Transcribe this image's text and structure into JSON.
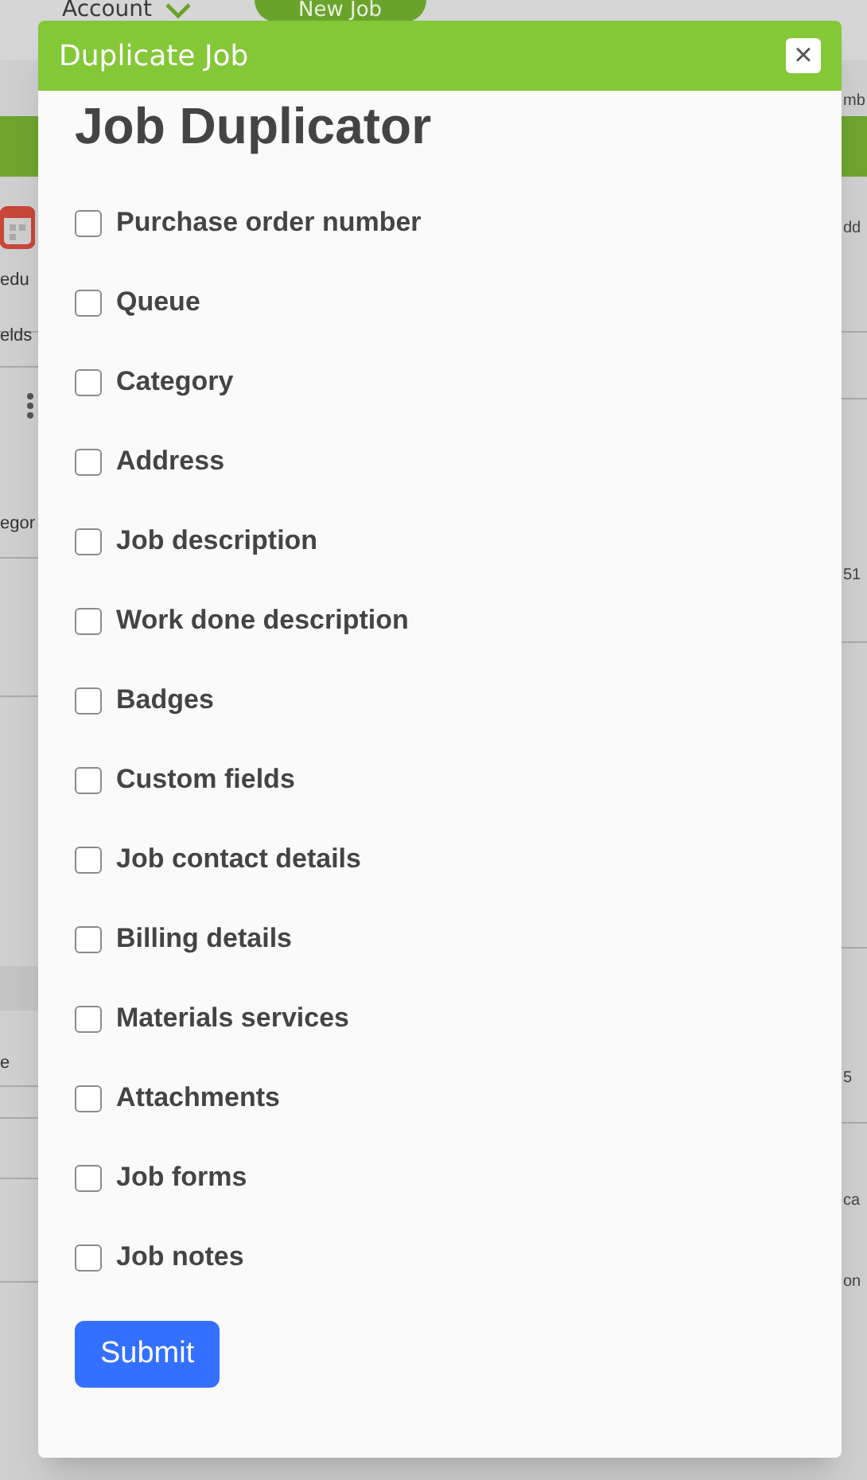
{
  "background": {
    "account_menu": "Account",
    "new_job_button": "New Job",
    "left_fragments": [
      "edu",
      "elds",
      "egor",
      "e"
    ],
    "right_fragments": [
      "mb",
      "dd",
      "51",
      "5",
      "ca",
      "on"
    ]
  },
  "dialog": {
    "title": "Duplicate Job",
    "close": "×",
    "heading": "Job Duplicator",
    "options": [
      {
        "label": "Purchase order number",
        "checked": false
      },
      {
        "label": "Queue",
        "checked": false
      },
      {
        "label": "Category",
        "checked": false
      },
      {
        "label": "Address",
        "checked": false
      },
      {
        "label": "Job description",
        "checked": false
      },
      {
        "label": "Work done description",
        "checked": false
      },
      {
        "label": "Badges",
        "checked": false
      },
      {
        "label": "Custom fields",
        "checked": false
      },
      {
        "label": "Job contact details",
        "checked": false
      },
      {
        "label": "Billing details",
        "checked": false
      },
      {
        "label": "Materials services",
        "checked": false
      },
      {
        "label": "Attachments",
        "checked": false
      },
      {
        "label": "Job forms",
        "checked": false
      },
      {
        "label": "Job notes",
        "checked": false
      }
    ],
    "submit": "Submit"
  }
}
